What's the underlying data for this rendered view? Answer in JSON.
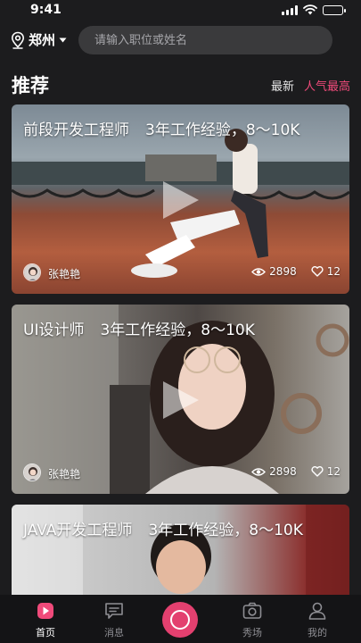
{
  "status": {
    "time": "9:41"
  },
  "header": {
    "city": "郑州",
    "search_placeholder": "请输入职位或姓名"
  },
  "section": {
    "title": "推荐",
    "sort_latest": "最新",
    "sort_popular": "人气最高"
  },
  "cards": [
    {
      "job": "前段开发工程师",
      "experience": "3年工作经验，8～10K",
      "author": "张艳艳",
      "views": "2898",
      "likes": "12"
    },
    {
      "job": "UI设计师",
      "experience": "3年工作经验，8～10K",
      "author": "张艳艳",
      "views": "2898",
      "likes": "12"
    },
    {
      "job": "JAVA开发工程师",
      "experience": "3年工作经验，8～10K"
    }
  ],
  "tabs": {
    "home": "首页",
    "messages": "消息",
    "show": "秀场",
    "mine": "我的"
  },
  "colors": {
    "accent": "#f04a7a",
    "background": "#1c1c1e"
  }
}
